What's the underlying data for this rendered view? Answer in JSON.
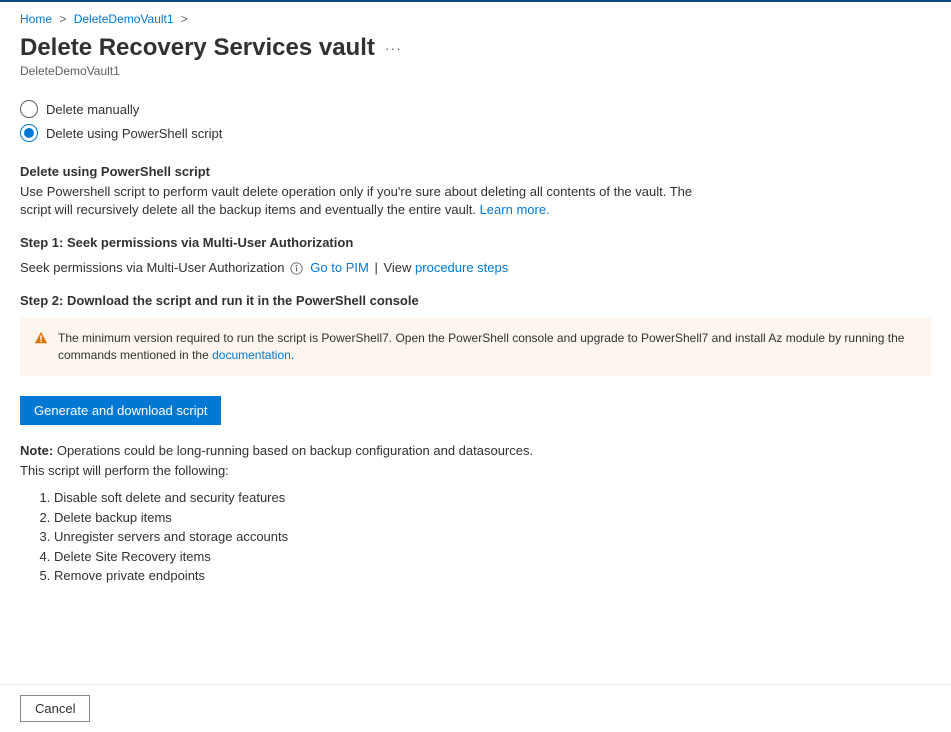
{
  "breadcrumb": {
    "home": "Home",
    "vault": "DeleteDemoVault1"
  },
  "header": {
    "title": "Delete Recovery Services vault",
    "subtitle": "DeleteDemoVault1"
  },
  "radios": {
    "manual": "Delete manually",
    "script": "Delete using PowerShell script",
    "selected": "script"
  },
  "script_section": {
    "heading": "Delete using PowerShell script",
    "description": "Use Powershell script to perform vault delete operation only if you're sure about deleting all contents of the vault. The script will recursively delete all the backup items and eventually the entire vault.",
    "learn_more": "Learn more."
  },
  "step1": {
    "heading": "Step 1: Seek permissions via Multi-User Authorization",
    "text": "Seek permissions via Multi-User Authorization",
    "go_to_pim": "Go to PIM",
    "view": "View",
    "procedure_steps": "procedure steps"
  },
  "step2": {
    "heading": "Step 2: Download the script and run it in the PowerShell console"
  },
  "warning": {
    "text": "The minimum version required to run the script is PowerShell7. Open the PowerShell console and upgrade to PowerShell7 and install Az module by running the commands mentioned in the ",
    "documentation": "documentation",
    "period": "."
  },
  "generate_button": "Generate and download script",
  "note": {
    "label": "Note:",
    "text": " Operations could be long-running based on backup configuration and datasources.",
    "intro": "This script will perform the following:"
  },
  "operations": [
    "Disable soft delete and security features",
    "Delete backup items",
    "Unregister servers and storage accounts",
    "Delete Site Recovery items",
    "Remove private endpoints"
  ],
  "footer": {
    "cancel": "Cancel"
  }
}
